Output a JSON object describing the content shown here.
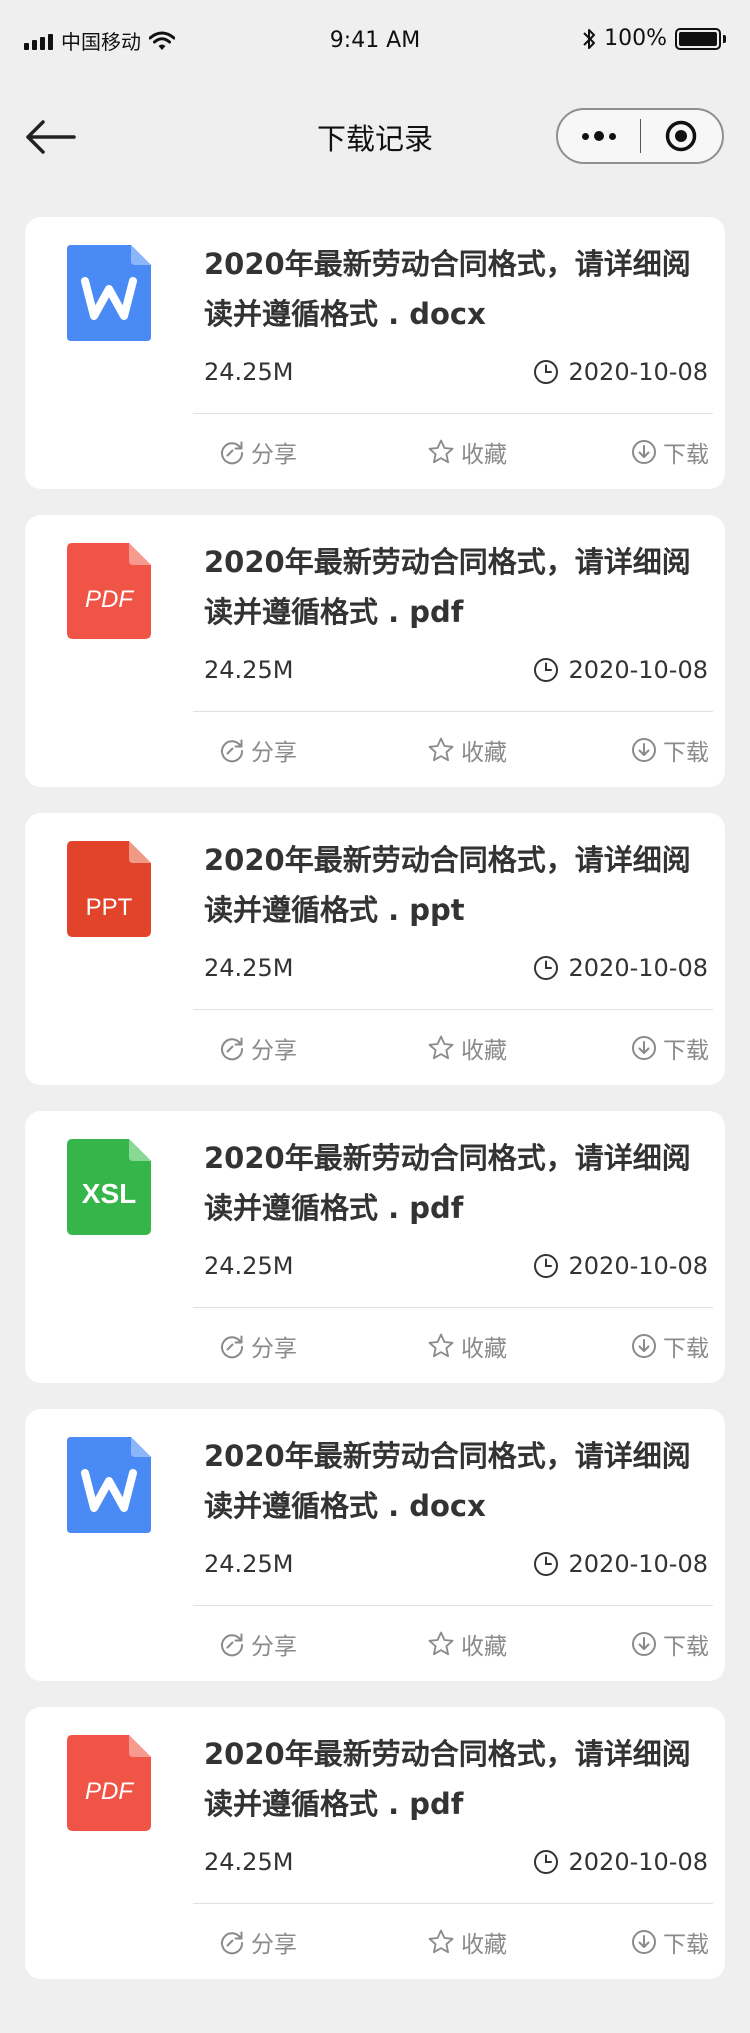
{
  "status_bar": {
    "carrier": "中国移动",
    "time": "9:41 AM",
    "battery": "100%"
  },
  "nav": {
    "title": "下载记录"
  },
  "actions": {
    "share": "分享",
    "favorite": "收藏",
    "download": "下载"
  },
  "files": [
    {
      "type": "word",
      "name": "2020年最新劳动合同格式，请详细阅读并遵循格式 . docx",
      "size": "24.25M",
      "date": "2020-10-08"
    },
    {
      "type": "pdf",
      "name": "2020年最新劳动合同格式，请详细阅读并遵循格式 . pdf",
      "size": "24.25M",
      "date": "2020-10-08",
      "icon_label": "PDF"
    },
    {
      "type": "ppt",
      "name": "2020年最新劳动合同格式，请详细阅读并遵循格式 . ppt",
      "size": "24.25M",
      "date": "2020-10-08",
      "icon_label": "PPT"
    },
    {
      "type": "xsl",
      "name": "2020年最新劳动合同格式，请详细阅读并遵循格式 . pdf",
      "size": "24.25M",
      "date": "2020-10-08",
      "icon_label": "XSL"
    },
    {
      "type": "word",
      "name": "2020年最新劳动合同格式，请详细阅读并遵循格式 . docx",
      "size": "24.25M",
      "date": "2020-10-08"
    },
    {
      "type": "pdf",
      "name": "2020年最新劳动合同格式，请详细阅读并遵循格式 . pdf",
      "size": "24.25M",
      "date": "2020-10-08",
      "icon_label": "PDF"
    }
  ],
  "colors": {
    "word": "#4a8af4",
    "pdf": "#f05446",
    "ppt": "#e2432b",
    "xsl": "#36b54a"
  }
}
